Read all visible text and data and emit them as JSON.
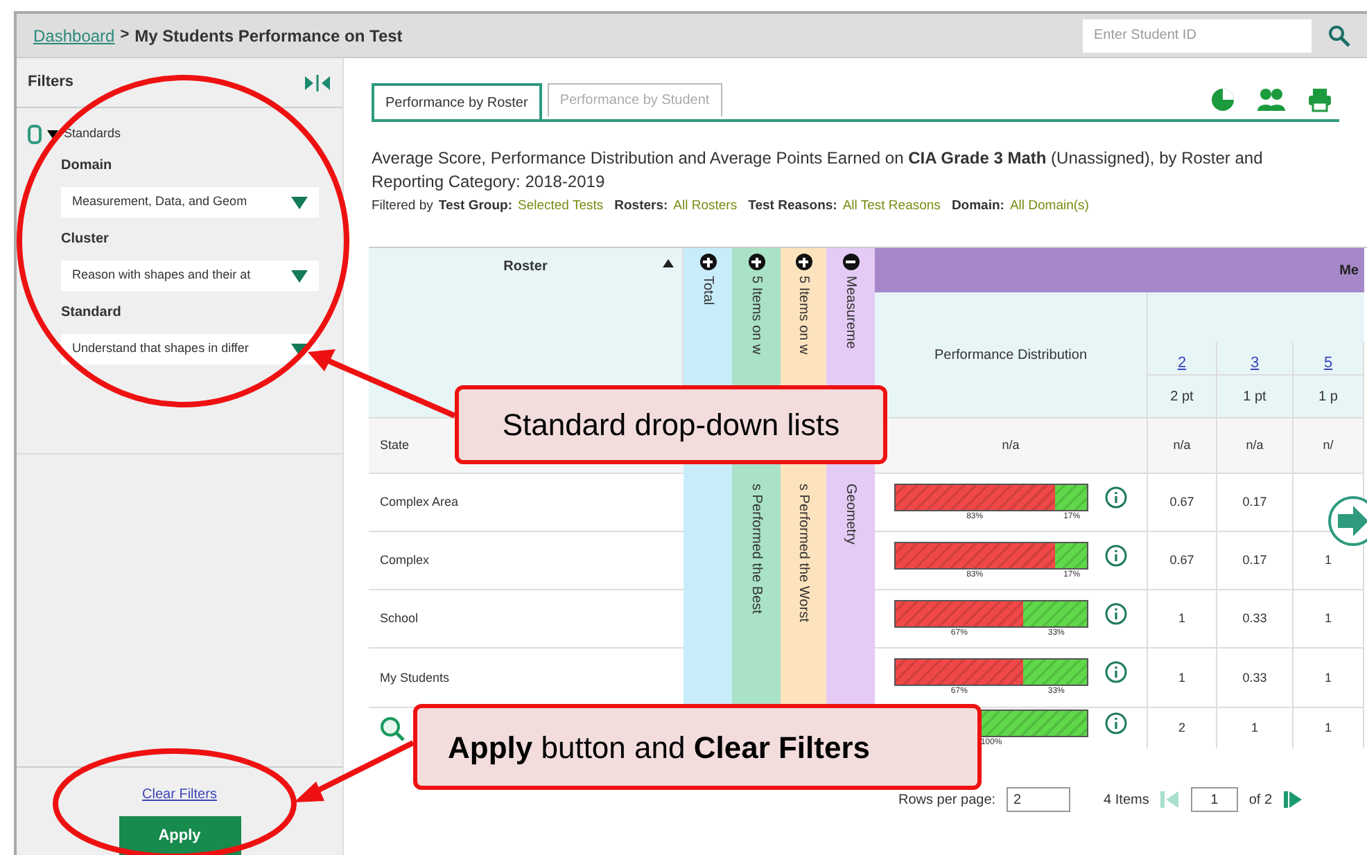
{
  "breadcrumb": {
    "link": "Dashboard",
    "separator": ">",
    "title": "My Students Performance on Test"
  },
  "student_search": {
    "placeholder": "Enter Student ID"
  },
  "filters": {
    "title": "Filters",
    "section": {
      "label": "Standards",
      "expanded": true,
      "fields": [
        {
          "label": "Domain",
          "value": "Measurement, Data, and Geom"
        },
        {
          "label": "Cluster",
          "value": "Reason with shapes and their at"
        },
        {
          "label": "Standard",
          "value": "Understand that shapes in differ"
        }
      ]
    },
    "clear_link": "Clear Filters",
    "apply_button": "Apply"
  },
  "tabs": [
    {
      "label": "Performance by Roster",
      "selected": true
    },
    {
      "label": "Performance by Student",
      "selected": false
    }
  ],
  "description": {
    "text": "Average Score, Performance Distribution and Average Points Earned on **CIA Grade 3 Math** (Unassigned), by Roster and Reporting Category: 2018-2019",
    "filtered_by": "Filtered by",
    "filters": [
      {
        "label": "Test Group:",
        "value": "Selected Tests"
      },
      {
        "label": "Rosters:",
        "value": "All Rosters"
      },
      {
        "label": "Test Reasons:",
        "value": "All Test Reasons"
      },
      {
        "label": "Domain:",
        "value": "All Domain(s)"
      }
    ]
  },
  "table": {
    "roster_header": "Roster",
    "strips": [
      {
        "top": "Total",
        "expanded": false,
        "color": "#c9ecfa"
      },
      {
        "top": "5 Items on w",
        "bottom": "s Performed the Best",
        "expanded": false,
        "color": "#a9e2c6"
      },
      {
        "top": "5 Items on w",
        "bottom": "s Performed the Worst",
        "expanded": false,
        "color": "#fde3bd"
      },
      {
        "top": "Measureme",
        "bottom": "Geometry",
        "expanded": true,
        "color": "#e4cbf5"
      }
    ],
    "group_header": "Me",
    "distribution_header": "Performance Distribution",
    "point_columns": [
      {
        "number": "2",
        "points": "2 pt"
      },
      {
        "number": "3",
        "points": "1 pt"
      },
      {
        "number": "5",
        "points": "1 p"
      }
    ],
    "rows": [
      {
        "kind": "summary",
        "name": "State",
        "distribution": "n/a",
        "values": [
          "n/a",
          "n/a",
          "n/"
        ]
      },
      {
        "kind": "roster",
        "name": "Complex Area",
        "segments": [
          {
            "level": 0.83,
            "label": "83%",
            "color": "#f04848"
          },
          {
            "level": 0.17,
            "label": "17%",
            "color": "#5fd84a"
          }
        ],
        "values": [
          "0.67",
          "0.17"
        ]
      },
      {
        "kind": "roster",
        "name": "Complex",
        "segments": [
          {
            "level": 0.83,
            "label": "83%",
            "color": "#f04848"
          },
          {
            "level": 0.17,
            "label": "17%",
            "color": "#5fd84a"
          }
        ],
        "values": [
          "0.67",
          "0.17",
          "1"
        ]
      },
      {
        "kind": "roster",
        "name": "School",
        "segments": [
          {
            "level": 0.67,
            "label": "67%",
            "color": "#f04848"
          },
          {
            "level": 0.33,
            "label": "33%",
            "color": "#5fd84a"
          }
        ],
        "values": [
          "1",
          "0.33",
          "1"
        ]
      },
      {
        "kind": "roster",
        "name": "My Students",
        "segments": [
          {
            "level": 0.67,
            "label": "67%",
            "color": "#f04848"
          },
          {
            "level": 0.33,
            "label": "33%",
            "color": "#5fd84a"
          }
        ],
        "values": [
          "1",
          "0.33",
          "1"
        ]
      },
      {
        "kind": "search",
        "segments": [
          {
            "level": 1,
            "label": "100%",
            "color": "#5fd84a"
          }
        ],
        "values": [
          "2",
          "1",
          "1"
        ]
      }
    ]
  },
  "pagination": {
    "rows_label": "Rows per page:",
    "rows_value": "2",
    "items": "4 Items",
    "page_value": "1",
    "of_pages": "of 2"
  },
  "callouts": [
    {
      "text": "Standard drop-down lists"
    },
    {
      "text": "**Apply** button and **Clear Filters**"
    }
  ]
}
